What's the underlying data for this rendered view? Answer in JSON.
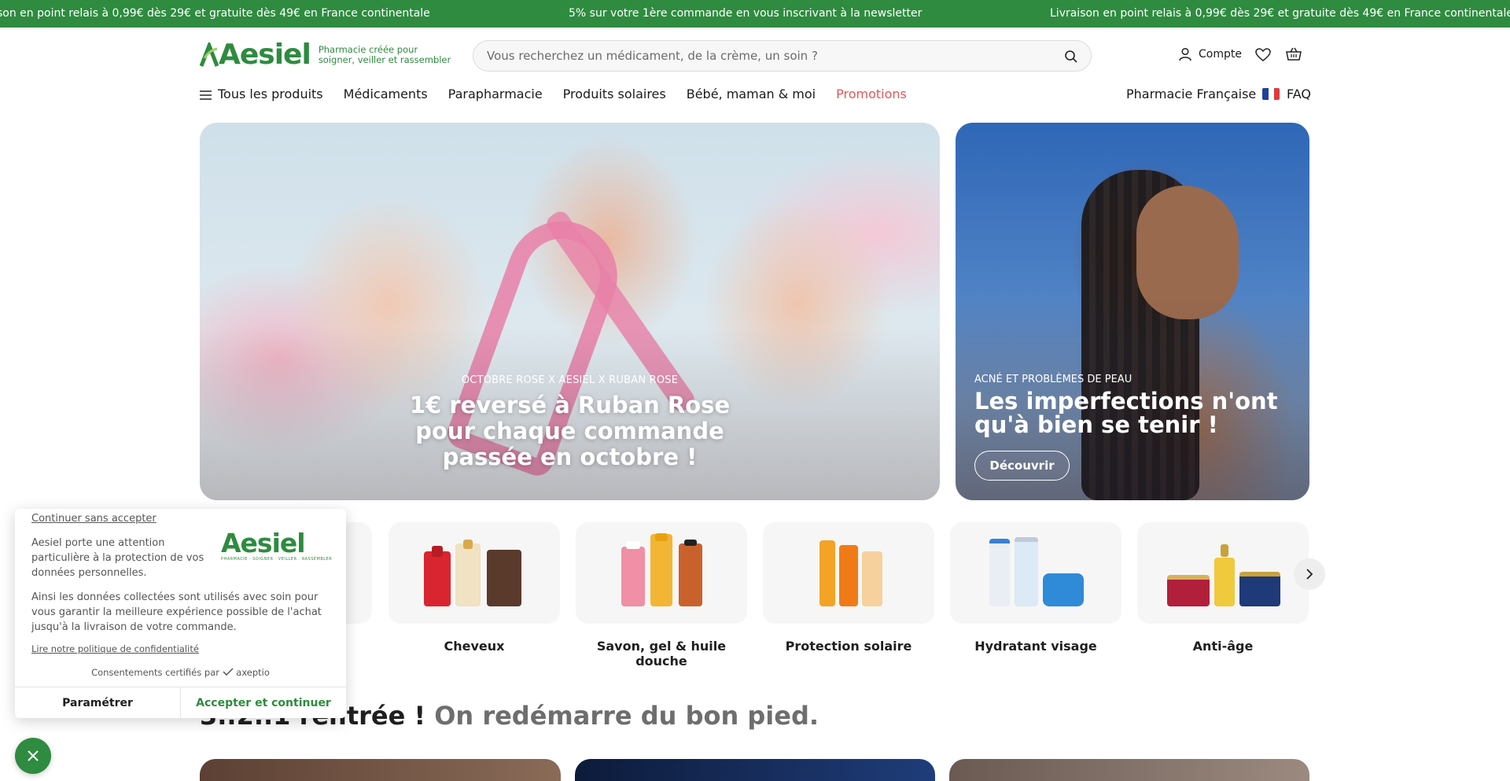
{
  "announcement": {
    "messages": [
      "son en point relais à 0,99€ dès 29€ et gratuite dès 49€ en France continentale",
      "5% sur votre 1ère commande en vous inscrivant à la newsletter",
      "Livraison en point relais à 0,99€ dès 29€ et gratuite dès 49€ en France continentale"
    ],
    "bg_color": "#2e8b3f"
  },
  "header": {
    "logo_text": "Aesiel",
    "tagline": "Pharmacie créée pour soigner, veiller et rassembler",
    "search_placeholder": "Vous recherchez un médicament, de la crème, un soin ?",
    "account_label": "Compte",
    "icons": [
      "user-icon",
      "heart-icon",
      "basket-icon",
      "search-icon"
    ]
  },
  "nav": {
    "items": [
      "Tous les produits",
      "Médicaments",
      "Parapharmacie",
      "Produits solaires",
      "Bébé, maman & moi",
      "Promotions"
    ],
    "pharmacy_label": "Pharmacie Française",
    "faq_label": "FAQ",
    "promo_color": "#e5555a"
  },
  "hero": {
    "main": {
      "eyebrow": "OCTOBRE ROSE X AESIEL X RUBAN ROSE",
      "headline": "1€ reversé à Ruban Rose pour chaque commande passée en octobre !"
    },
    "side": {
      "eyebrow": "ACNÉ ET PROBLÈMES DE PEAU",
      "headline": "Les imperfections n'ont qu'à bien se tenir !",
      "cta": "Découvrir"
    }
  },
  "categories": [
    {
      "label": "Cheveux"
    },
    {
      "label": "Savon, gel & huile douche"
    },
    {
      "label": "Protection solaire"
    },
    {
      "label": "Hydratant visage"
    },
    {
      "label": "Anti-âge"
    }
  ],
  "section": {
    "title_strong": "3..2..1 rentrée !",
    "title_muted": "On redémarre du bon pied."
  },
  "consent": {
    "skip": "Continuer sans accepter",
    "text1": "Aesiel porte une attention particulière à la protection de vos données personnelles.",
    "text2": "Ainsi les données collectées sont utilisés avec soin pour vous garantir la meilleure expérience possible de l'achat jusqu'à la livraison de votre commande.",
    "policy_link": "Lire notre politique de confidentialité",
    "certified": "Consentements certifiés par",
    "certifier": "axeptio",
    "logo_text": "Aesiel",
    "logo_tagline": "PHARMACIE · SOIGNER · VEILLER · RASSEMBLER",
    "btn_settings": "Paramétrer",
    "btn_accept": "Accepter et continuer"
  }
}
